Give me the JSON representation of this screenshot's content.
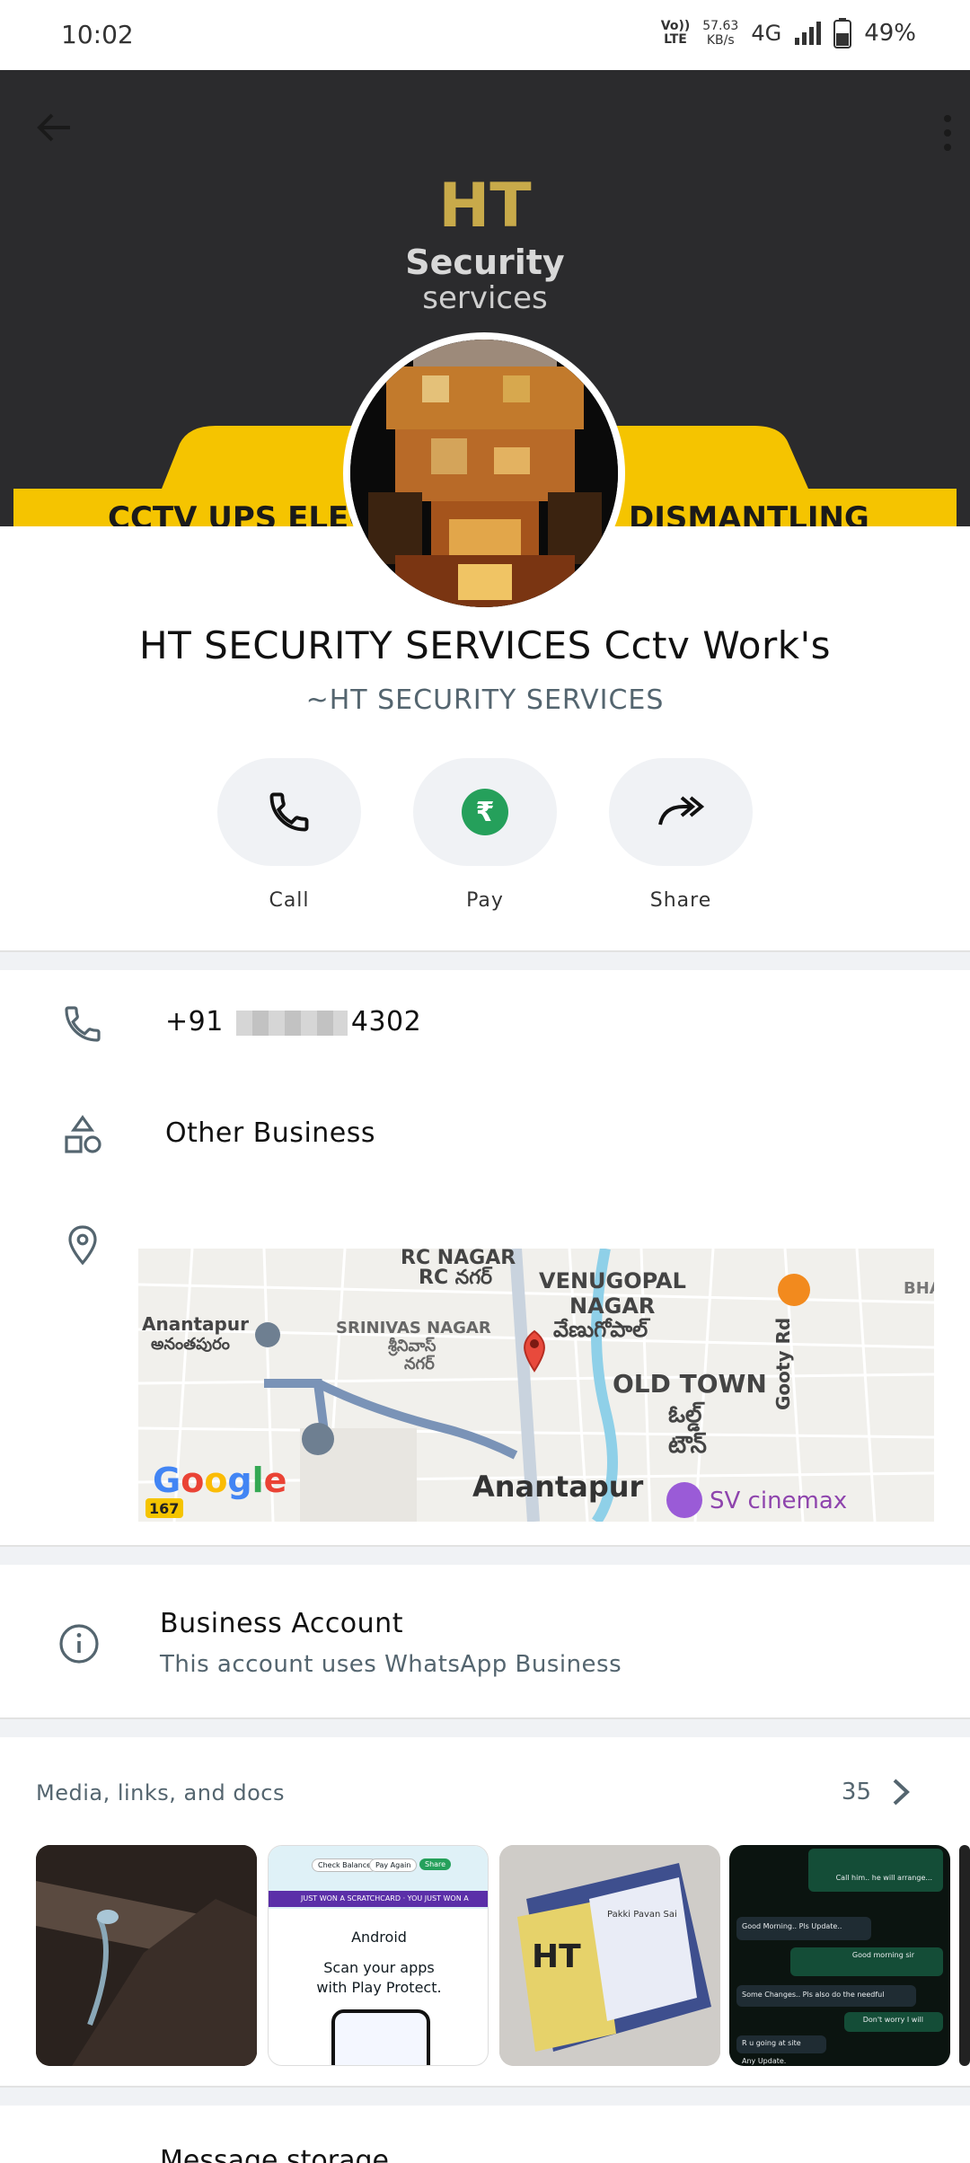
{
  "status_bar": {
    "time": "10:02",
    "volte": "Vo)) LTE",
    "speed_value": "57.63",
    "speed_unit": "KB/s",
    "network": "4G",
    "battery": "49%"
  },
  "cover": {
    "brand_title": "HT",
    "brand_line1": "Security",
    "brand_line2": "services",
    "banner_text_left": "CCTV UPS ELEC",
    "banner_text_right": "DISMANTLING"
  },
  "profile": {
    "name": "HT SECURITY SERVICES Cctv Work's",
    "subtitle": "~HT SECURITY SERVICES"
  },
  "actions": [
    {
      "label": "Call",
      "icon": "phone-icon"
    },
    {
      "label": "Pay",
      "icon": "rupee-icon"
    },
    {
      "label": "Share",
      "icon": "share-icon"
    }
  ],
  "contact": {
    "phone_prefix": "+91",
    "phone_suffix": "4302",
    "category": "Other Business"
  },
  "map": {
    "labels": {
      "rc_nagar": "RC NAGAR",
      "rc_nagar_te": "RC నగర్",
      "venugopal": "VENUGOPAL",
      "venugopal2": "NAGAR",
      "venugopal_te": "వేణుగోపాల్",
      "srinivas": "SRINIVAS NAGAR",
      "srinivas_te": "శ్రీనివాస్",
      "srinivas_te2": "నగర్",
      "anantapur_left": "Anantapur",
      "anantapur_left_te": "అనంతపురం",
      "old_town": "OLD TOWN",
      "old_town_te": "ఓల్డ్",
      "old_town_te2": "టౌన్",
      "gooty_rd": "Gooty Rd",
      "bha": "BHA",
      "anantapur_center": "Anantapur",
      "sv_cinemax": "SV cinemax",
      "road_shield": "167",
      "google": "Google"
    }
  },
  "business": {
    "title": "Business Account",
    "subtitle": "This account uses WhatsApp Business"
  },
  "media": {
    "heading": "Media, links, and docs",
    "count": "35",
    "thumb2": {
      "banner": "JUST WON A SCRATCHCARD · YOU JUST WON A",
      "os": "Android",
      "line1": "Scan your apps",
      "line2": "with Play Protect.",
      "btn1": "Check Balance",
      "btn2": "Pay Again",
      "btn3": "Share"
    },
    "thumb3": {
      "logo": "HT",
      "name": "Pakki Pavan Sai"
    },
    "thumb4": {
      "m1": "Call him.. he will arrange...",
      "m2": "Good Morning.. Pls Update..",
      "m3": "Good morning sir",
      "m4": "Some Changes.. Pls also do the needful",
      "m5": "Don't worry I will",
      "m6": "R u going at site",
      "m7": "Any Update."
    }
  },
  "next_section": {
    "label": "Message storage"
  },
  "colors": {
    "accent_green": "#25a05b",
    "cover_dark": "#2b2b2d",
    "brand_gold": "#c8aa4a",
    "banner_yellow": "#f5c400"
  }
}
